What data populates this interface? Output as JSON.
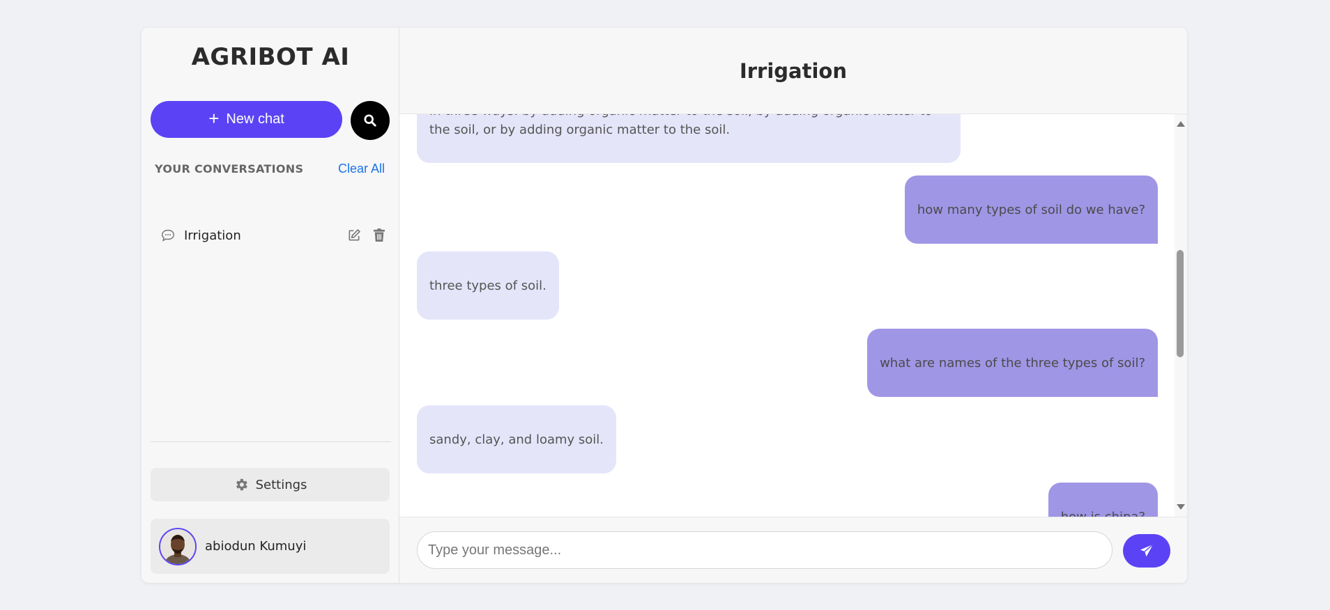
{
  "sidebar": {
    "brand": "AGRIBOT AI",
    "new_chat_label": "New chat",
    "conversations_title": "YOUR CONVERSATIONS",
    "clear_all_label": "Clear All",
    "conversations": [
      {
        "label": "Irrigation"
      }
    ],
    "settings_label": "Settings",
    "user_name": "abiodun Kumuyi"
  },
  "main": {
    "title": "Irrigation",
    "messages": [
      {
        "role": "bot",
        "text": "in three ways: by adding organic matter to the soil, by adding organic matter to the soil, or by adding organic matter to the soil."
      },
      {
        "role": "user",
        "text": "how many types of soil do we have?"
      },
      {
        "role": "bot",
        "text": "three types of soil."
      },
      {
        "role": "user",
        "text": "what are names of the three types of soil?"
      },
      {
        "role": "bot",
        "text": "sandy, clay, and loamy soil."
      },
      {
        "role": "user",
        "text": "how is chipa?"
      }
    ],
    "input_placeholder": "Type your message..."
  },
  "colors": {
    "accent": "#5b43f5",
    "bot_bubble": "#e5e5fa",
    "user_bubble": "#a096e6",
    "link": "#1a73e8"
  },
  "icons": {
    "new_chat": "plus-icon",
    "search": "search-icon",
    "conversation": "chat-bubble-icon",
    "edit": "edit-icon",
    "delete": "trash-icon",
    "settings": "gear-icon",
    "send": "paper-plane-icon"
  }
}
